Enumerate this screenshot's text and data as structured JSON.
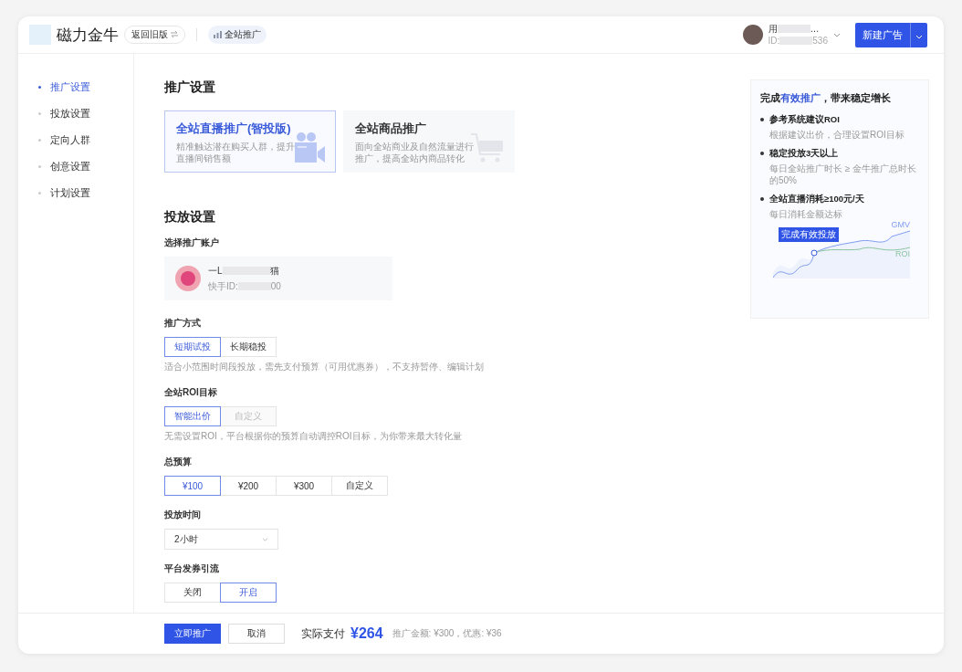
{
  "header": {
    "logo_text": "磁力金牛",
    "old_version": "返回旧版",
    "breadcrumb": "全站推广",
    "user": {
      "name_start": "用",
      "name_end": "…",
      "id_start": "ID:",
      "id_end": "536"
    },
    "new_ad": "新建广告"
  },
  "sidebar": {
    "items": [
      {
        "label": "推广设置",
        "selected": true
      },
      {
        "label": "投放设置",
        "selected": false
      },
      {
        "label": "定向人群",
        "selected": false
      },
      {
        "label": "创意设置",
        "selected": false
      },
      {
        "label": "计划设置",
        "selected": false
      }
    ]
  },
  "promo": {
    "title": "推广设置",
    "cards": [
      {
        "kind": "live",
        "title": "全站直播推广(智投版)",
        "desc": "精准触达潜在购买人群，提升直播间销售额",
        "selected": true
      },
      {
        "kind": "goods",
        "title": "全站商品推广",
        "desc": "面向全站商业及自然流量进行推广，提高全站内商品转化",
        "selected": false
      }
    ]
  },
  "delivery": {
    "title": "投放设置",
    "account_label": "选择推广账户",
    "account": {
      "name_start": "一L",
      "name_end": "猫",
      "id_label": "快手ID:",
      "id_end": "00"
    },
    "groups": [
      {
        "kind": "segmented",
        "label": "推广方式",
        "options": [
          {
            "label": "短期试投",
            "selected": true,
            "disabled": false
          },
          {
            "label": "长期稳投",
            "selected": false,
            "disabled": false
          }
        ],
        "hint": "适合小范围时间段投放，需先支付预算（可用优惠券），不支持暂停、编辑计划"
      },
      {
        "kind": "segmented",
        "label": "全站ROI目标",
        "options": [
          {
            "label": "智能出价",
            "selected": true,
            "disabled": false
          },
          {
            "label": "自定义",
            "selected": false,
            "disabled": true
          }
        ],
        "hint": "无需设置ROI，平台根据你的预算自动调控ROI目标，为你带来最大转化量"
      },
      {
        "kind": "segmented",
        "label": "总预算",
        "options": [
          {
            "label": "¥100",
            "selected": true,
            "disabled": false
          },
          {
            "label": "¥200",
            "selected": false,
            "disabled": false
          },
          {
            "label": "¥300",
            "selected": false,
            "disabled": false
          },
          {
            "label": "自定义",
            "selected": false,
            "disabled": false
          }
        ]
      },
      {
        "kind": "select",
        "label": "投放时间",
        "value": "2小时"
      },
      {
        "kind": "segmented",
        "label": "平台发券引流",
        "options": [
          {
            "label": "关闭",
            "selected": false,
            "disabled": false
          },
          {
            "label": "开启",
            "selected": true,
            "disabled": false
          }
        ]
      }
    ]
  },
  "tips": {
    "title": "完成**有效推广**，带来稳定增长",
    "items": [
      {
        "title": "参考系统建议ROI",
        "desc": "根据建议出价，合理设置ROI目标"
      },
      {
        "title": "稳定投放3天以上",
        "desc": "每日全站推广时长 ≥ 金牛推广总时长的50%"
      },
      {
        "title": "全站直播消耗≥100元/天",
        "desc": "每日消耗金额达标"
      }
    ],
    "chart_tag": "完成有效投放",
    "line_labels": [
      "GMV",
      "ROI"
    ]
  },
  "footer": {
    "submit": "立即推广",
    "cancel": "取消",
    "pay_label": "实际支付",
    "pay_amount": "¥264",
    "pay_detail": "推广金额: ¥300，优惠: ¥36"
  }
}
